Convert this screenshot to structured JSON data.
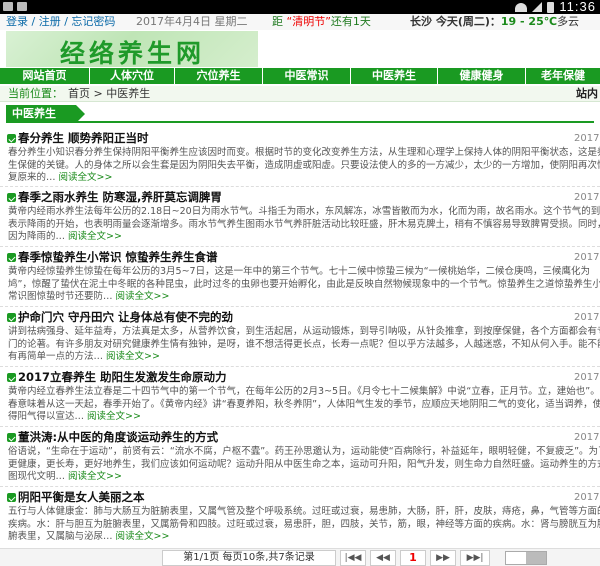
{
  "status_bar": {
    "time": "11:36"
  },
  "top_bar": {
    "login": "登录 / 注册 / 忘记密码",
    "date": "2017年4月4日 星期二",
    "countdown_prefix": "距",
    "countdown_event": "“清明节”",
    "countdown_suffix": "还有1天",
    "weather_city_day": "长沙  今天(周二)：",
    "weather_temp": "19 - 25℃",
    "weather_desc": "多云"
  },
  "logo": {
    "text": "经络养生网"
  },
  "nav": {
    "items": [
      "网站首页",
      "人体穴位",
      "穴位养生",
      "中医常识",
      "中医养生",
      "健康健身",
      "老年保健"
    ]
  },
  "breadcrumb": {
    "label": "当前位置：",
    "home": "首页",
    "separator": " > ",
    "current": "中医养生",
    "right_text": "站内"
  },
  "section": {
    "title": "中医养生"
  },
  "articles": [
    {
      "title": "春分养生 顺势养阳正当时",
      "date": "2017",
      "summary": "春分养生小知识春分养生保持阴阳平衡养生应该因时而变。根据时节的变化改变养生方法，从生理和心理学上保持人体的阴阳平衡状态，这是养生保健的关键。人的身体之所以会生套是因为阴阳失去平衡，造成阴虚或阳虚。只要设法使人的多的一方减少，太少的一方增加，使阴阳再次恢复原来的…",
      "more": "阅读全文>>"
    },
    {
      "title": "春季之雨水养生 防寒湿,养肝莫忘调脾胃",
      "date": "2017",
      "summary": "黄帝内经雨水养生法每年公历的2.18日~20日为雨水节气。斗指壬为雨水，东风解冻，冰雪皆散而为水，化而为雨，故名雨水。这个节气的到来表示降雨的开始，也表明雨量会逐渐增多。雨水节气养生图雨水节气养肝脏活动比较旺盛，肝木易克脾土，稍有不慎容易导致脾胃受损。同时，因为降雨的…",
      "more": "阅读全文>>"
    },
    {
      "title": "春季惊蛰养生小常识 惊蛰养生养生食谱",
      "date": "2017",
      "summary": "黄帝内经惊蛰养生惊蛰在每年公历的3月5~7日，这是一年中的第三个节气。七十二候中惊蛰三候为“一候桃始华，二候仓庚鸣，三候鹰化为鸠”，惊醒了蛰伏在泥土中冬眠的各种昆虫，此时过冬的虫卵也要开始孵化，由此是反映自然物候现象中的一个节气。惊蛰养生之道惊蛰养生小常识图惊蛰时节还要防…",
      "more": "阅读全文>>"
    },
    {
      "title": "护命门穴 守丹田穴 让身体总有使不完的劲",
      "date": "2017",
      "summary": "讲到祛病强身、延年益寿，方法真是太多，从营养饮食，到生活起居，从运动锻炼，到导引呐吸，从针灸推拿，到按摩保健，各个方面都会有专门的论著。有许多朋友对研究健康养生情有独钟，是呀，谁不想活得更长点，长寿一点呢？但以乎方法越多，人越迷惑，不知从何入手。能不能有再简单一点的方法…",
      "more": "阅读全文>>"
    },
    {
      "title": "2017立春养生 助阳生发激发生命原动力",
      "date": "2017",
      "summary": "黄帝内经立春养生法立春是二十四节气中的第一个节气，在每年公历的2月3~5日。《月令七十二候集解》中说“立春，正月节。立，建始也”。立春意味着从这一天起，春季开始了。《黄帝内经》讲“春夏养阳，秋冬养阴”，人体阳气生发的季节，应顺应天地阴阳二气的变化，适当调养，使得阳气得以宣达…",
      "more": "阅读全文>>"
    },
    {
      "title": "董洪涛:从中医的角度谈运动养生的方式",
      "date": "2017",
      "summary": "俗语说，“生命在于运动”，前贤有云：“流水不腐，户枢不蠹”。药王孙思邈认为，运动能使“百病除行，补益延年，眼明轻健，不复疲乏”。为了更健康，更长寿，更好地养生，我们应该如何运动呢？运动升阳从中医生命之本，运动可升阳，阳气升发，则生命力自然旺盛。运动养生的方式图现代文明…",
      "more": "阅读全文>>"
    },
    {
      "title": "阴阳平衡是女人美丽之本",
      "date": "2017",
      "summary": "五行与人体健康金：肺与大肠互为脏腑表里，又属气管及整个呼吸系统。过旺或过衰，易患肺，大肠，肝，肝，皮肤，痔疮，鼻，气管等方面的疾病。水：肝与胆互为脏腑表里，又属筋骨和四肢。过旺或过衰，易患肝，胆，四肢，关节，筋，眼，神经等方面的疾病。水：肾与膀胱互为脏腑表里，又属脑与泌尿…",
      "more": "阅读全文>>"
    }
  ],
  "pager": {
    "info": "第1/1页  每页10条,共7条记录",
    "first": "|◀◀",
    "prev": "◀◀",
    "current": "1",
    "next": "▶▶",
    "last": "▶▶|"
  }
}
